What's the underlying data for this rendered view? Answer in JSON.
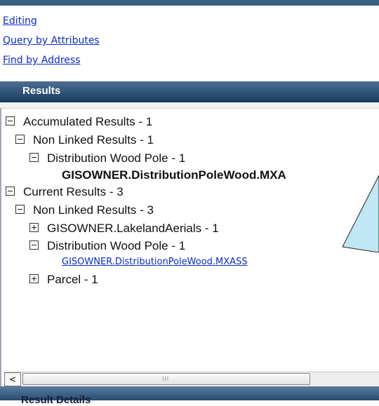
{
  "nav": {
    "links": [
      "Editing",
      "Query by Attributes",
      "Find by Address"
    ]
  },
  "results": {
    "header": "Results",
    "tree": [
      {
        "label": "Accumulated Results - 1",
        "expander": "minus",
        "level": 0
      },
      {
        "label": "Non Linked Results - 1",
        "expander": "minus",
        "level": 1
      },
      {
        "label": "Distribution Wood Pole - 1",
        "expander": "minus",
        "level": 2
      },
      {
        "label": "GISOWNER.DistributionPoleWood.MXA",
        "expander": "none",
        "level": 3,
        "style": "bold"
      },
      {
        "label": "Current Results - 3",
        "expander": "minus",
        "level": 0
      },
      {
        "label": "Non Linked Results - 3",
        "expander": "minus",
        "level": 1
      },
      {
        "label": "GISOWNER.LakelandAerials - 1",
        "expander": "plus",
        "level": 2
      },
      {
        "label": "Distribution Wood Pole - 1",
        "expander": "minus",
        "level": 2
      },
      {
        "label": "GISOWNER.DistributionPoleWood.MXASS",
        "expander": "none",
        "level": 3,
        "style": "link"
      },
      {
        "label": "Parcel - 1",
        "expander": "plus",
        "level": 2
      }
    ]
  },
  "scrollbar": {
    "left_arrow": "<",
    "grip": "III"
  },
  "details": {
    "label": "Result Details"
  },
  "colors": {
    "header": "#1f4266",
    "link": "#0b2cc4",
    "callout": "#bfe8f4"
  }
}
